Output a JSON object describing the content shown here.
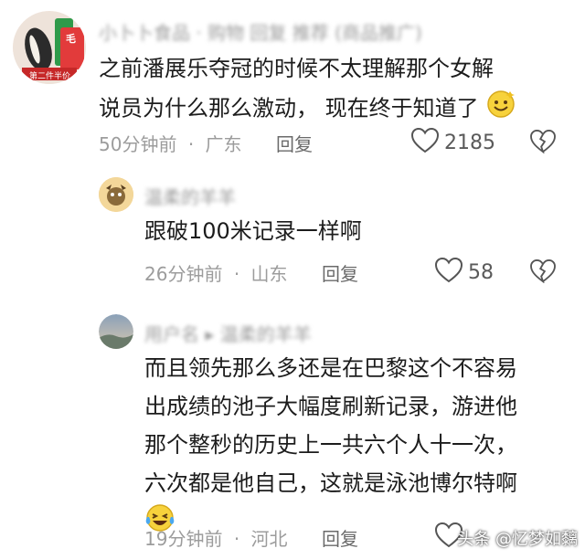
{
  "comments": [
    {
      "username": "小卜卜食品 · 购物 回复 推荐 (商品推广)",
      "lines": [
        "之前潘展乐夺冠的时候不太理解那个女解",
        "说员为什么那么激动， 现在终于知道了"
      ],
      "time": "50分钟前",
      "location": "广东",
      "reply_label": "回复",
      "likes": "2185",
      "avatar_text_1": "毛",
      "avatar_text_2": "第二件半价"
    },
    {
      "username": "温柔的羊羊",
      "lines": [
        "跟破100米记录一样啊"
      ],
      "time": "26分钟前",
      "location": "山东",
      "reply_label": "回复",
      "likes": "58"
    },
    {
      "username": "用户名 ▸ 温柔的羊羊",
      "lines": [
        "而且领先那么多还是在巴黎这个不容易",
        "出成绩的池子大幅度刷新记录，游进他",
        "那个整秒的历史上一共六个人十一次，",
        "六次都是他自己，这就是泳池博尔特啊"
      ],
      "time": "19分钟前",
      "location": "河北",
      "reply_label": "回复"
    }
  ],
  "separator": "·",
  "watermark": "头条 @忆梦如黐",
  "colors": {
    "heart": "#555555",
    "meta": "#9c9c9c"
  }
}
